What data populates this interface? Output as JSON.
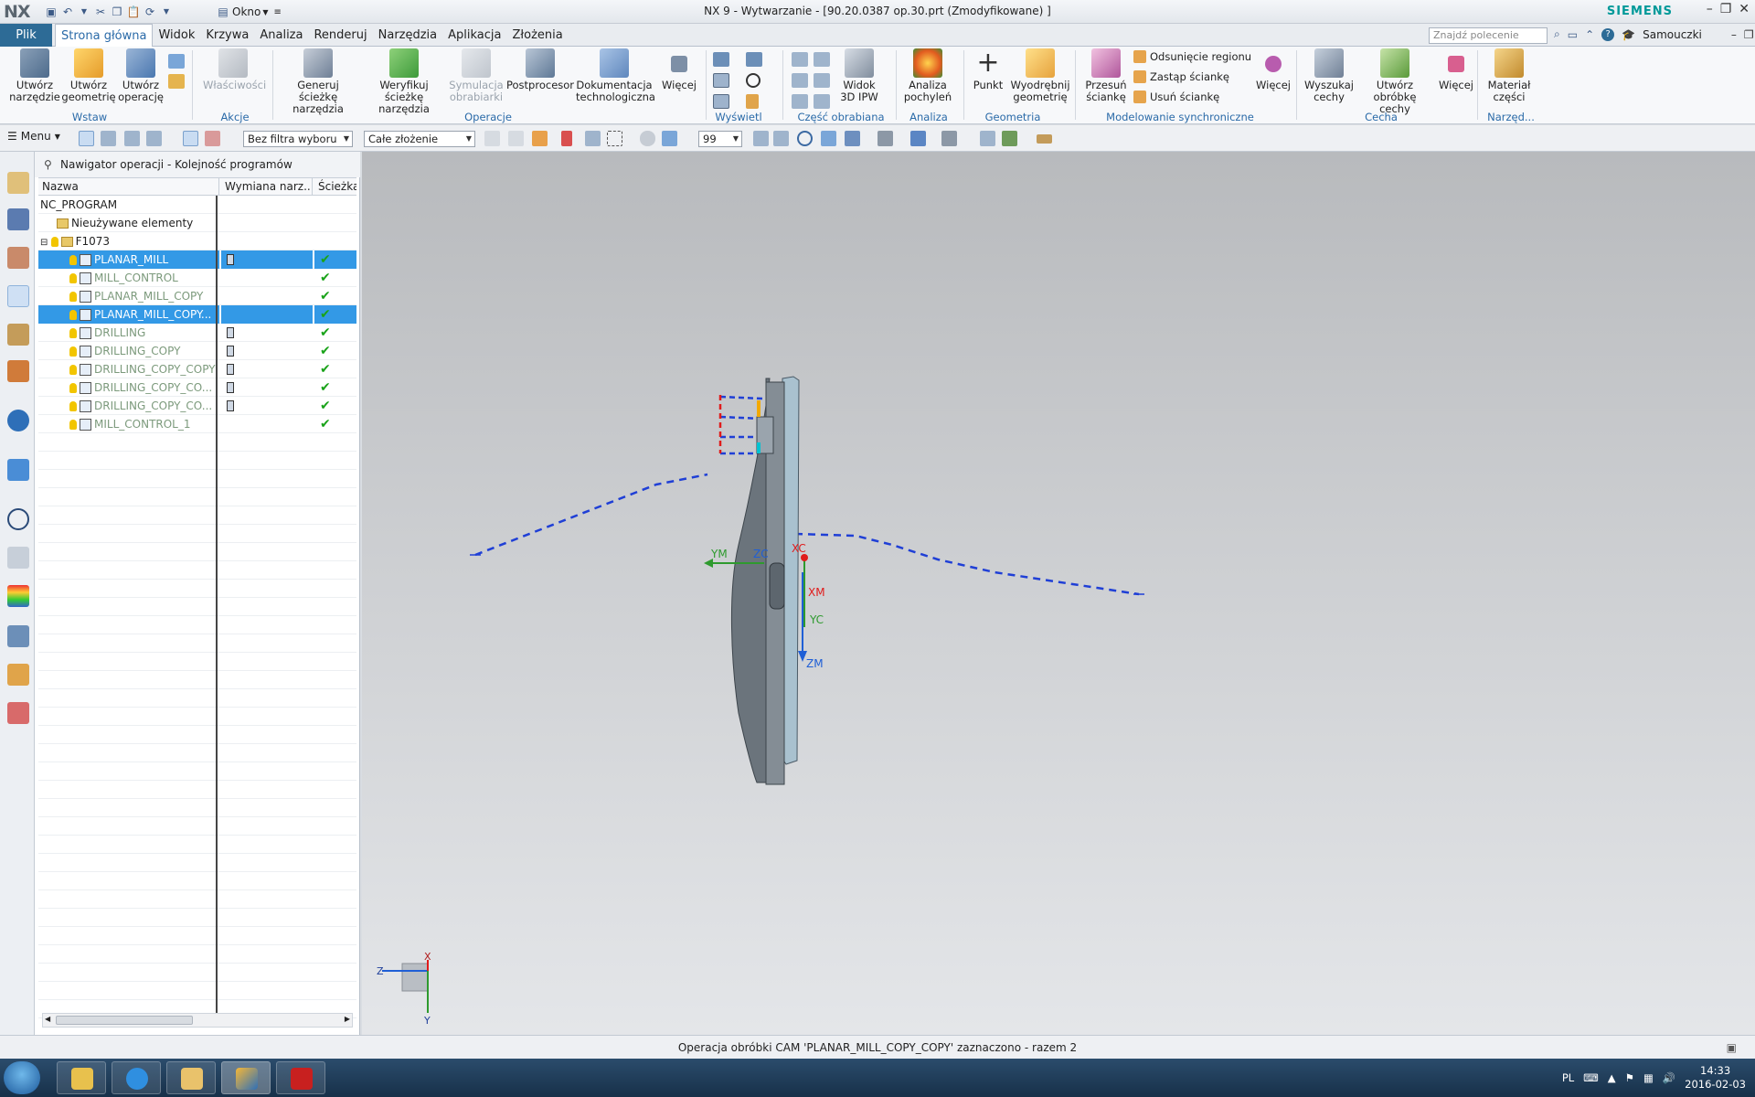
{
  "app": {
    "logo": "NX",
    "title": "NX 9 - Wytwarzanie - [90.20.0387 op.30.prt (Zmodyfikowane) ]",
    "brand": "SIEMENS",
    "window_menu": "Okno"
  },
  "menu": {
    "file": "Plik",
    "tabs": [
      "Strona główna",
      "Widok",
      "Krzywa",
      "Analiza",
      "Renderuj",
      "Narzędzia",
      "Aplikacja",
      "Złożenia"
    ],
    "active_tab": "Strona główna",
    "search_placeholder": "Znajdź polecenie",
    "tutorials": "Samouczki"
  },
  "ribbon": {
    "create_tool": "Utwórz narzędzie",
    "create_geometry": "Utwórz geometrię",
    "create_operation": "Utwórz operację",
    "group_insert": "Wstaw",
    "properties": "Właściwości",
    "group_actions": "Akcje",
    "generate_path": "Generuj ścieżkę narzędzia",
    "verify_path": "Weryfikuj ścieżkę narzędzia",
    "machine_sim": "Symulacja obrabiarki",
    "postprocessor": "Postprocesor",
    "shop_doc": "Dokumentacja technologiczna",
    "more": "Więcej",
    "group_operations": "Operacje",
    "group_display": "Wyświetl",
    "view_3d_ipw": "Widok 3D IPW",
    "group_workpiece": "Część obrabiana",
    "draft_analysis": "Analiza pochyleń",
    "group_analysis": "Analiza",
    "point": "Punkt",
    "extract_geometry": "Wyodrębnij geometrię",
    "group_geometry": "Geometria",
    "move_face": "Przesuń ściankę",
    "offset_region": "Odsunięcie regionu",
    "replace_face": "Zastąp ściankę",
    "delete_face": "Usuń ściankę",
    "group_sync": "Modelowanie synchroniczne",
    "find_features": "Wyszukaj cechy",
    "create_feature_process": "Utwórz obróbkę cechy",
    "group_feature": "Cecha",
    "part_material": "Materiał części",
    "group_tools": "Narzęd..."
  },
  "selection": {
    "menu": "Menu",
    "filter": "Bez filtra wyboru",
    "scope": "Całe złożenie",
    "value": "99"
  },
  "navigator": {
    "title": "Nawigator operacji - Kolejność programów",
    "columns": [
      "Nazwa",
      "Wymiana narz...",
      "Ścieżka"
    ],
    "rows": [
      {
        "name": "NC_PROGRAM",
        "kind": "root",
        "tool": false,
        "path": false,
        "selected": false
      },
      {
        "name": "Nieużywane elementy",
        "kind": "folder",
        "tool": false,
        "path": false,
        "selected": false
      },
      {
        "name": "F1073",
        "kind": "group",
        "tool": false,
        "path": false,
        "selected": false
      },
      {
        "name": "PLANAR_MILL",
        "kind": "op",
        "tool": true,
        "path": true,
        "selected": true
      },
      {
        "name": "MILL_CONTROL",
        "kind": "op",
        "tool": false,
        "path": true,
        "selected": false
      },
      {
        "name": "PLANAR_MILL_COPY",
        "kind": "op",
        "tool": false,
        "path": true,
        "selected": false
      },
      {
        "name": "PLANAR_MILL_COPY...",
        "kind": "op",
        "tool": false,
        "path": true,
        "selected": true
      },
      {
        "name": "DRILLING",
        "kind": "op",
        "tool": true,
        "path": true,
        "selected": false
      },
      {
        "name": "DRILLING_COPY",
        "kind": "op",
        "tool": true,
        "path": true,
        "selected": false
      },
      {
        "name": "DRILLING_COPY_COPY",
        "kind": "op",
        "tool": true,
        "path": true,
        "selected": false
      },
      {
        "name": "DRILLING_COPY_CO...",
        "kind": "op",
        "tool": true,
        "path": true,
        "selected": false
      },
      {
        "name": "DRILLING_COPY_CO...",
        "kind": "op",
        "tool": true,
        "path": true,
        "selected": false
      },
      {
        "name": "MILL_CONTROL_1",
        "kind": "op",
        "tool": false,
        "path": true,
        "selected": false
      }
    ]
  },
  "viewport": {
    "axes": {
      "ym": "YM",
      "zc": "ZC",
      "xc": "XC",
      "xm": "XM",
      "yc": "YC",
      "zm": "ZM"
    },
    "triad": {
      "z": "Z",
      "x": "X",
      "y": "Y"
    }
  },
  "status": "Operacja obróbki CAM 'PLANAR_MILL_COPY_COPY' zaznaczono - razem 2",
  "taskbar": {
    "lang": "PL",
    "time": "14:33",
    "date": "2016-02-03"
  },
  "colors": {
    "accent": "#2d6b96",
    "selection": "#3399e6",
    "check": "#1aa31a",
    "toolpath": "#1f3fd6",
    "siemens": "#009999"
  }
}
